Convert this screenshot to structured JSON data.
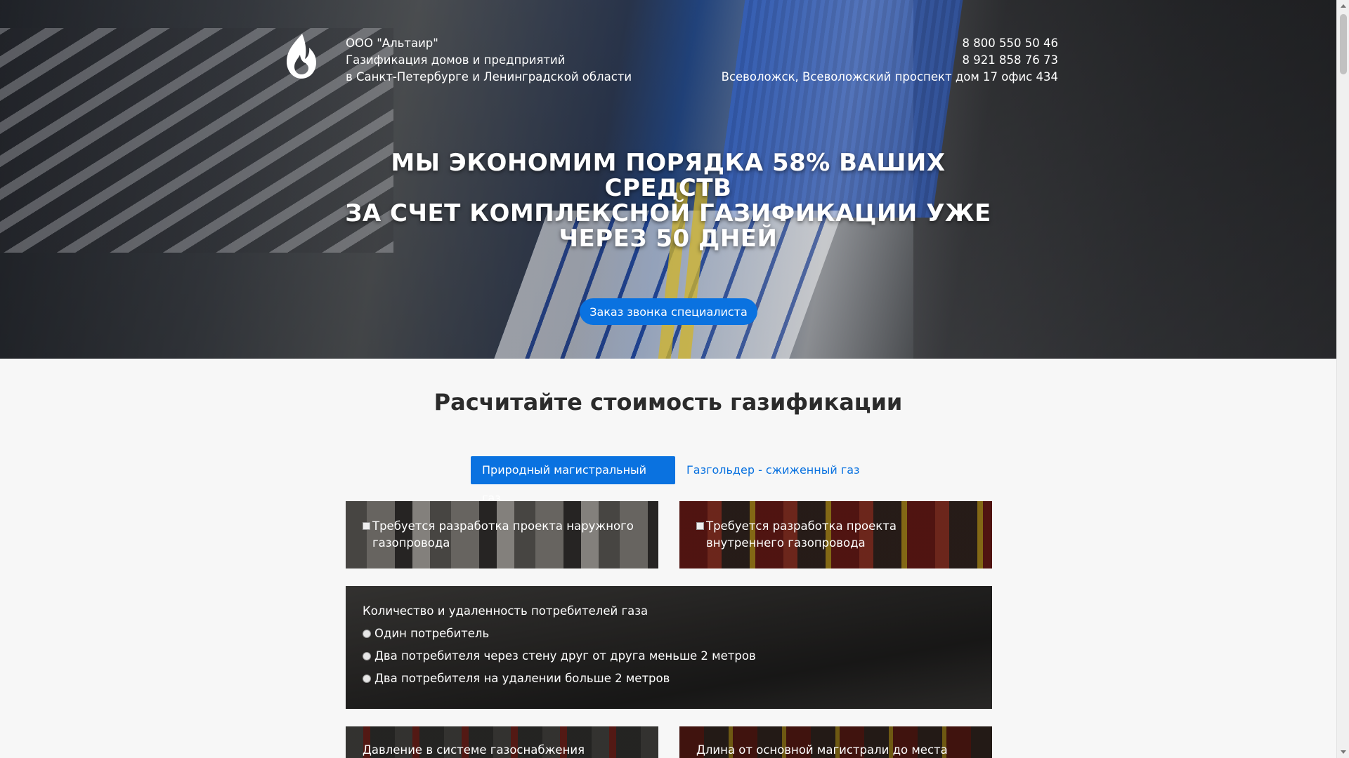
{
  "header": {
    "company_lines": [
      "ООО \"Альтаир\"",
      "Газификация домов и предприятий",
      "в Санкт-Петербурге и Ленинградской области"
    ],
    "phones": [
      "8 800 550 50 46",
      "8 921 858 76 73"
    ],
    "address": "Всеволожск, Всеволожский проспект дом 17 офис 434",
    "logo_icon": "flame-icon"
  },
  "hero": {
    "headline_lines": [
      "МЫ ЭКОНОМИМ ПОРЯДКА 58% ВАШИХ СРЕДСТВ",
      "ЗА СЧЕТ КОМПЛЕКСНОЙ ГАЗИФИКАЦИИ УЖЕ",
      "ЧЕРЕЗ 50 ДНЕЙ"
    ],
    "cta_label": "Заказ звонка специалиста"
  },
  "calculator": {
    "title": "Расчитайте стоимость газификации",
    "tabs": [
      {
        "label": "Природный магистральный газ",
        "active": true
      },
      {
        "label": "Газгольдер - сжиженный газ",
        "active": false
      }
    ],
    "options": [
      {
        "label": "Требуется разработка проекта наружного газопровода",
        "checked": false
      },
      {
        "label": "Требуется разработка проекта внутреннего газопровода",
        "checked": false
      }
    ],
    "consumers": {
      "title": "Количество и удаленность потребителей газа",
      "choices": [
        "Один потребитель",
        "Два потребителя через стену друг от друга меньше 2 метров",
        "Два потребителя на удалении больше 2 метров"
      ]
    },
    "pressure_label": "Давление в системе газоснабжения",
    "distance_label": "Длина от основной магистрали до места"
  },
  "colors": {
    "accent": "#0a72e0",
    "text_dark": "#2b2b2b",
    "hero_text": "#ffffff"
  }
}
